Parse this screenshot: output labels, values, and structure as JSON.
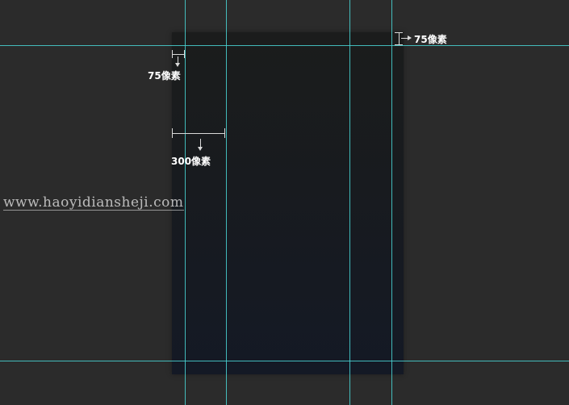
{
  "annotations": {
    "margin_left_label": "75像素",
    "column_width_label": "300像素",
    "margin_top_label": "75像素"
  },
  "watermark": {
    "text": "www.haoyidiansheji.com"
  },
  "colors": {
    "workspace_background": "#2b2b2b",
    "artboard_background": "#181b1f",
    "guide_color": "#49d6d6",
    "annotation_color": "#ffffff"
  }
}
